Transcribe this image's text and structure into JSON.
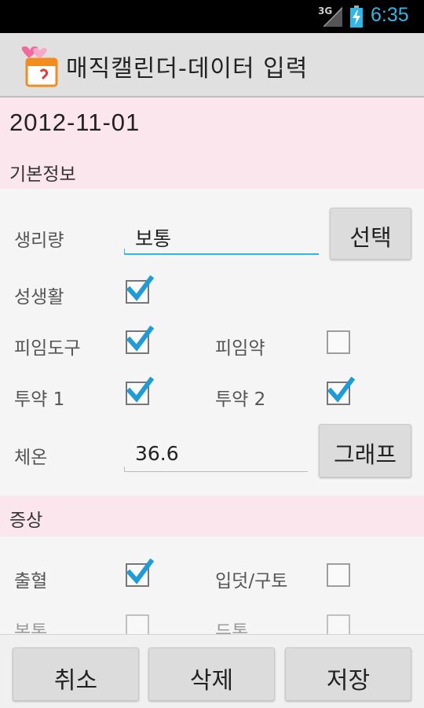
{
  "status_bar": {
    "network": "3G",
    "time": "6:35",
    "accent": "#33b5e5"
  },
  "action_bar": {
    "icon": "calendar-hearts-icon",
    "title": "매직캘린더-데이터 입력"
  },
  "date": "2012-11-01",
  "basic_section": {
    "title": "기본정보",
    "flow": {
      "label": "생리량",
      "value": "보통",
      "button": "선택"
    },
    "sex": {
      "label": "성생활",
      "checked": true
    },
    "contraceptive_device": {
      "label": "피임도구",
      "checked": true
    },
    "contraceptive_pill": {
      "label": "피임약",
      "checked": false
    },
    "medication1": {
      "label": "투약 1",
      "checked": true
    },
    "medication2": {
      "label": "투약 2",
      "checked": true
    },
    "temperature": {
      "label": "체온",
      "value": "36.6",
      "button": "그래프"
    }
  },
  "symptoms_section": {
    "title": "증상",
    "bleeding": {
      "label": "출혈",
      "checked": true
    },
    "nausea": {
      "label": "입덧/구토",
      "checked": false
    },
    "abdominal_pain": {
      "label": "복통",
      "checked": false
    },
    "headache": {
      "label": "두통",
      "checked": false
    }
  },
  "bottom_bar": {
    "cancel": "취소",
    "delete": "삭제",
    "save": "저장"
  },
  "colors": {
    "pink_band": "#fbe6ee",
    "check_blue": "#1f9bd7"
  }
}
